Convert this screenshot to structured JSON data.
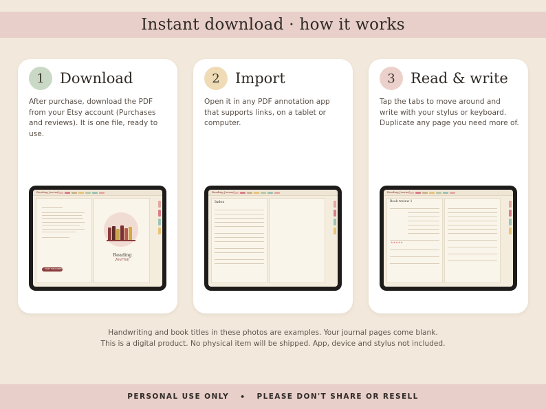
{
  "header": {
    "title": "Instant download · how it works"
  },
  "steps": [
    {
      "number": "1",
      "title": "Download",
      "body": "After purchase, download the PDF from your Etsy account (Purchases and reviews). It is one file, ready to use.",
      "screen": {
        "logo": "Reading Journal",
        "cover_title": "Reading",
        "cover_subtitle": "Journal",
        "button": "START THE JOURNEY"
      }
    },
    {
      "number": "2",
      "title": "Import",
      "body": "Open it in any PDF annotation app that supports links, on a tablet or computer.",
      "screen": {
        "logo": "Reading Journal",
        "page_title": "Index"
      }
    },
    {
      "number": "3",
      "title": "Read & write",
      "body": "Tap the tabs to move around and write with your stylus or keyboard. Duplicate any page you need more of.",
      "screen": {
        "logo": "Reading Journal",
        "page_title": "Book review 1"
      }
    }
  ],
  "notes": {
    "line1": "Handwriting and book titles in these photos are examples. Your journal pages come blank.",
    "line2": "This is a digital product. No physical item will be shipped. App, device and stylus not included."
  },
  "footer": {
    "left": "PERSONAL USE ONLY",
    "separator": "•",
    "right": "PLEASE DON'T SHARE OR RESELL"
  },
  "colors": {
    "background": "#f2e9dc",
    "banner": "#e8cfc9",
    "step1_circle": "#c9d9c5",
    "step2_circle": "#efdcb6",
    "step3_circle": "#ecd1cb",
    "accent_red": "#8a3b3b"
  }
}
